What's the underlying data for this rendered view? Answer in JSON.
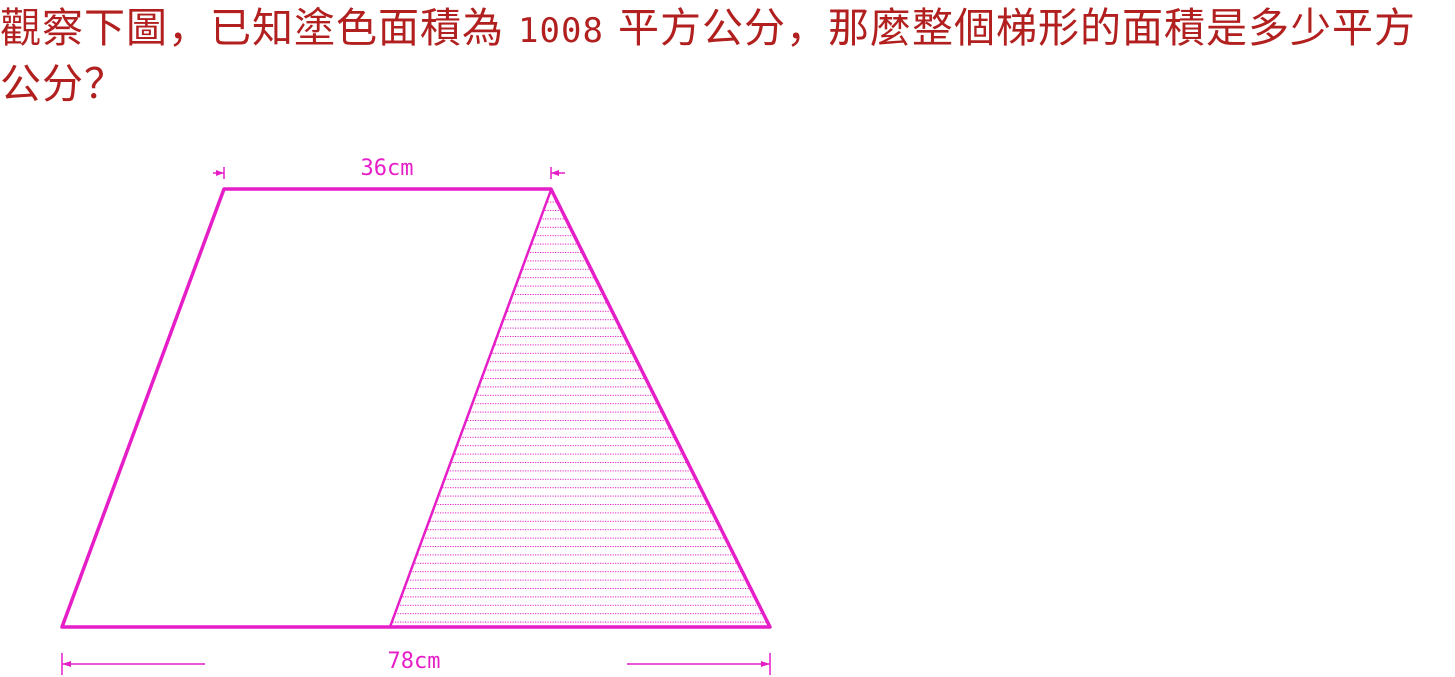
{
  "question": {
    "before_number": "觀察下圖，已知塗色面積為 ",
    "number": "1008",
    "after_number": " 平方公分，那麼整個梯形的面積是多少平方公分？"
  },
  "figure": {
    "color": "#e61ec8",
    "top_base_label": "36cm",
    "bottom_base_label": "78cm"
  }
}
